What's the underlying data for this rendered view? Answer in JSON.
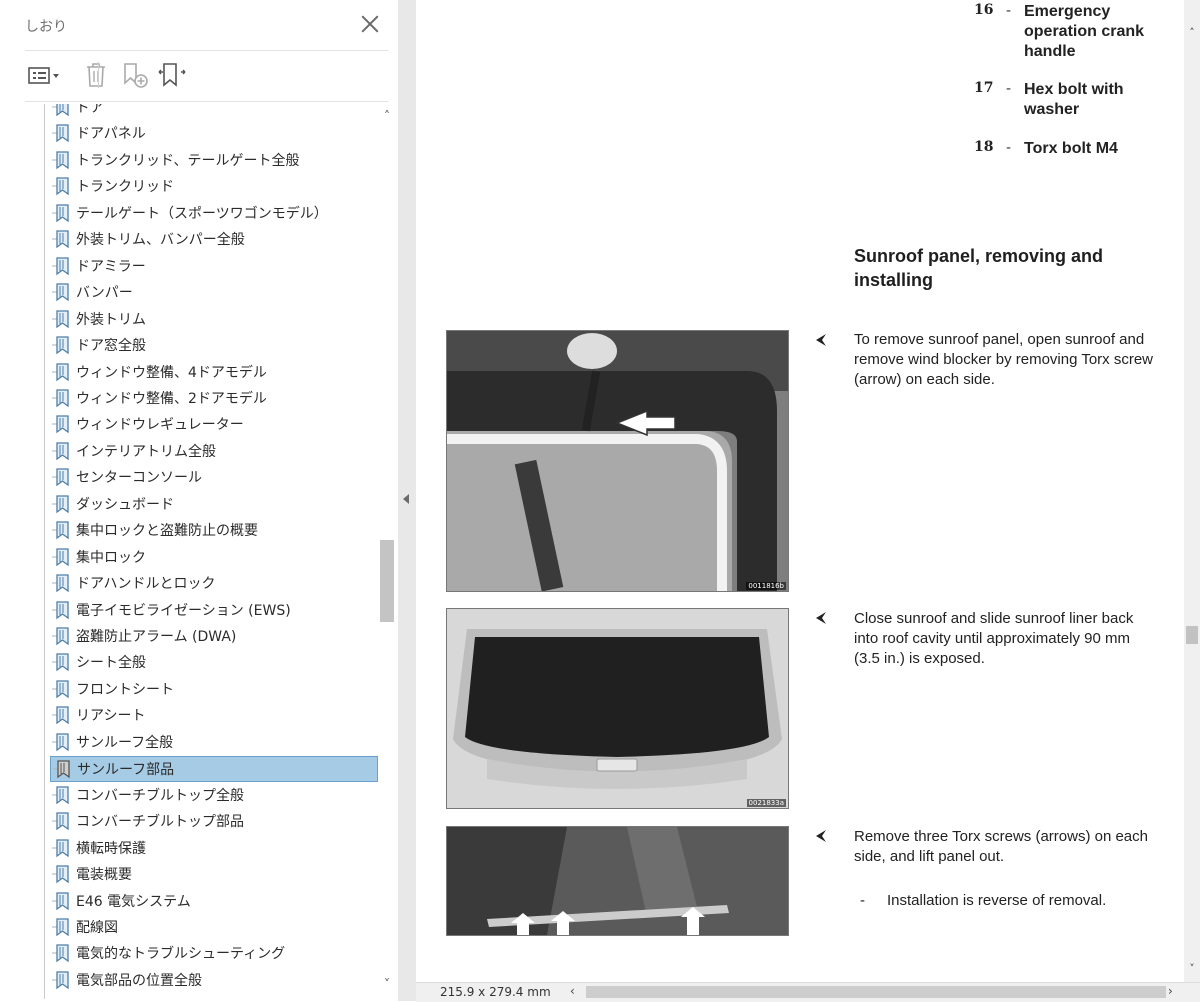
{
  "panel": {
    "title": "しおり",
    "options_icon": "options-menu-icon",
    "toolbar_icons": [
      "options-menu-icon",
      "delete-bookmark-icon",
      "new-bookmark-icon",
      "expand-bookmark-icon"
    ]
  },
  "bookmarks": [
    {
      "label": "ドア"
    },
    {
      "label": "ドアパネル"
    },
    {
      "label": "トランクリッド、テールゲート全般"
    },
    {
      "label": "トランクリッド"
    },
    {
      "label": "テールゲート（スポーツワゴンモデル）"
    },
    {
      "label": "外装トリム、バンパー全般"
    },
    {
      "label": "ドアミラー"
    },
    {
      "label": "バンパー"
    },
    {
      "label": "外装トリム"
    },
    {
      "label": "ドア窓全般"
    },
    {
      "label": "ウィンドウ整備、4ドアモデル"
    },
    {
      "label": "ウィンドウ整備、2ドアモデル"
    },
    {
      "label": "ウィンドウレギュレーター"
    },
    {
      "label": "インテリアトリム全般"
    },
    {
      "label": "センターコンソール"
    },
    {
      "label": "ダッシュボード"
    },
    {
      "label": "集中ロックと盗難防止の概要"
    },
    {
      "label": "集中ロック"
    },
    {
      "label": "ドアハンドルとロック"
    },
    {
      "label": "電子イモビライゼーション (EWS)"
    },
    {
      "label": "盗難防止アラーム (DWA)"
    },
    {
      "label": "シート全般"
    },
    {
      "label": "フロントシート"
    },
    {
      "label": "リアシート"
    },
    {
      "label": "サンルーフ全般"
    },
    {
      "label": "サンルーフ部品",
      "selected": true
    },
    {
      "label": "コンバーチブルトップ全般"
    },
    {
      "label": "コンバーチブルトップ部品"
    },
    {
      "label": "横転時保護"
    },
    {
      "label": "電装概要"
    },
    {
      "label": "E46 電気システム"
    },
    {
      "label": "配線図"
    },
    {
      "label": "電気的なトラブルシューティング"
    },
    {
      "label": "電気部品の位置全般"
    }
  ],
  "document": {
    "items": [
      {
        "num": "16",
        "dash": "-",
        "text": "Emergency operation crank handle"
      },
      {
        "num": "17",
        "dash": "-",
        "text": "Hex bolt with washer"
      },
      {
        "num": "18",
        "dash": "-",
        "text": "Torx bolt M4"
      }
    ],
    "heading": "Sunroof panel, removing and installing",
    "steps": [
      {
        "text": "To remove sunroof panel, open sunroof and remove wind blocker by removing Torx screw (arrow) on each side.",
        "photo_code": "0011816b"
      },
      {
        "text": "Close sunroof and slide sunroof liner back into roof cavity until approximately 90 mm (3.5 in.) is exposed.",
        "photo_code": "0021833a"
      },
      {
        "text": "Remove three Torx screws (arrows) on each side, and lift panel out.",
        "photo_code": ""
      }
    ],
    "note": {
      "dash": "-",
      "text": "Installation is reverse of removal."
    }
  },
  "statusbar": {
    "page_size": "215.9 x 279.4 mm"
  },
  "colors": {
    "selection_bg": "#a6cbe5",
    "selection_border": "#6aa0c9",
    "panel_text": "#2b2b2b"
  }
}
